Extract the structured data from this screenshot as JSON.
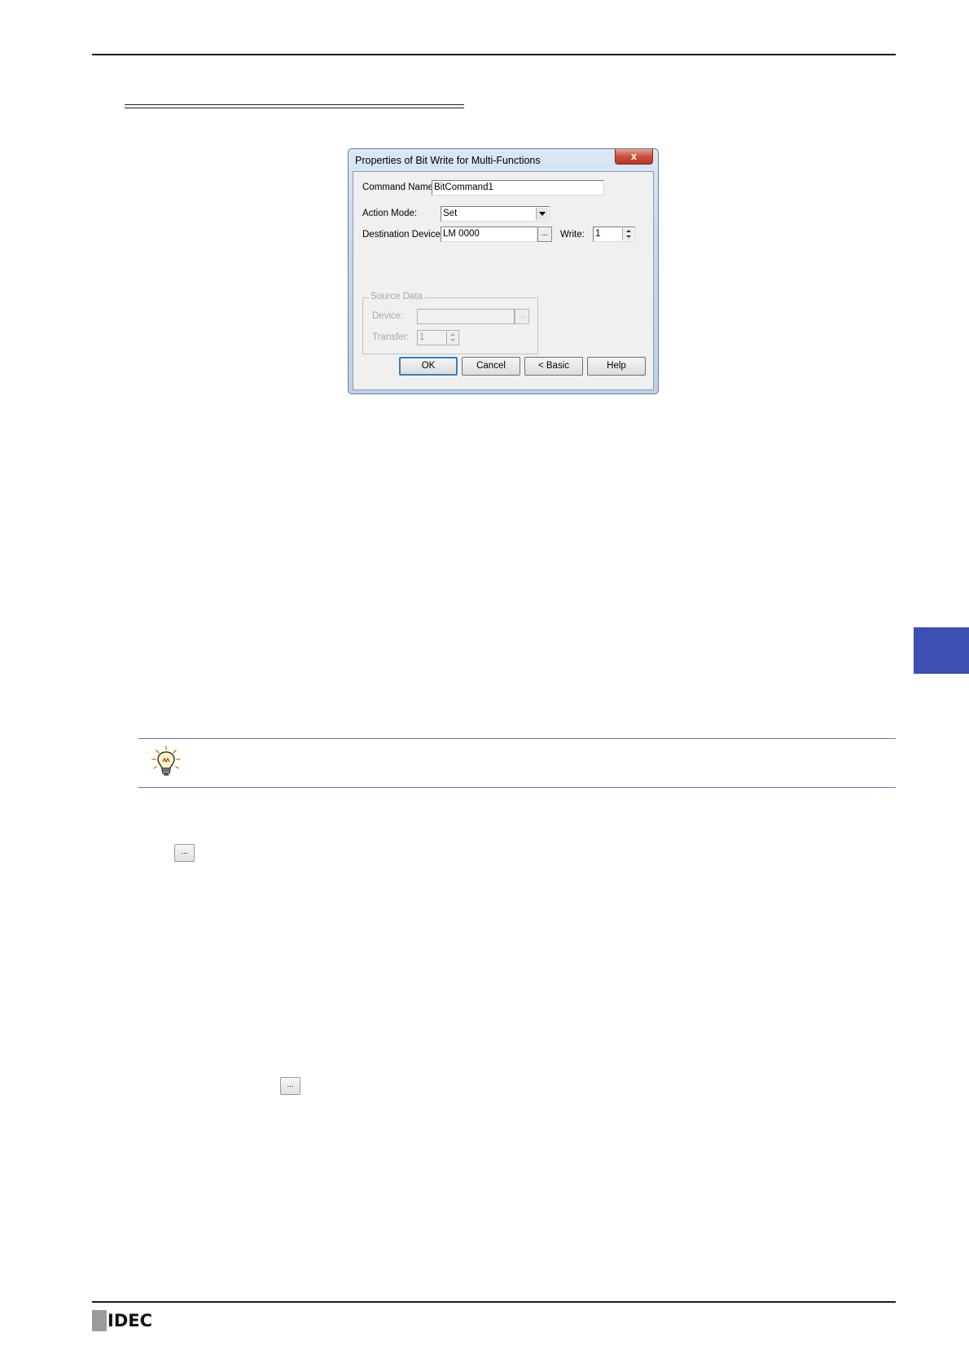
{
  "dialog": {
    "title": "Properties of Bit Write for Multi-Functions",
    "close_label": "x",
    "command_name_label": "Command Name:",
    "command_name_value": "BitCommand1",
    "action_mode_label": "Action Mode:",
    "action_mode_value": "Set",
    "destination_device_label": "Destination Device:",
    "destination_device_value": "LM 0000",
    "browse_label": "...",
    "write_label": "Write:",
    "write_value": "1",
    "source_data": {
      "group_label": "Source Data",
      "device_label": "Device:",
      "device_value": "",
      "browse_label": "...",
      "transfer_label": "Transfer:",
      "transfer_value": "1"
    },
    "buttons": {
      "ok": "OK",
      "cancel": "Cancel",
      "basic": "< Basic",
      "help": "Help"
    }
  },
  "page": {
    "ellipsis_button_1": "...",
    "ellipsis_button_2": "...",
    "logo_text": "IDEC",
    "tip_icon": "lightbulb-icon",
    "side_tab_color": "#3d4fb0"
  }
}
